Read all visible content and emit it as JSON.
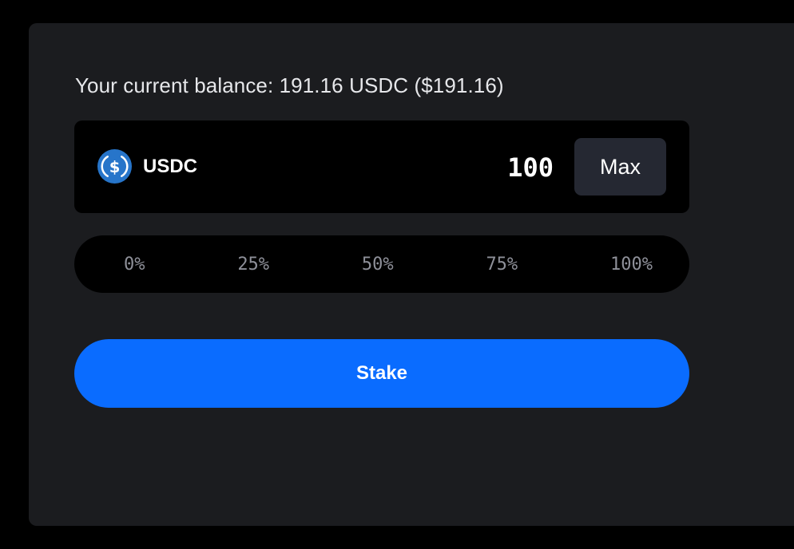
{
  "balance": {
    "text": "Your current balance: 191.16 USDC ($191.16)"
  },
  "token": {
    "icon": "usdc-dollar-icon",
    "symbol": "USDC",
    "icon_color": "#2775ca"
  },
  "amount": {
    "value": "100"
  },
  "max_button": {
    "label": "Max"
  },
  "percentages": [
    "0%",
    "25%",
    "50%",
    "75%",
    "100%"
  ],
  "stake_button": {
    "label": "Stake",
    "color": "#0a6cff"
  }
}
